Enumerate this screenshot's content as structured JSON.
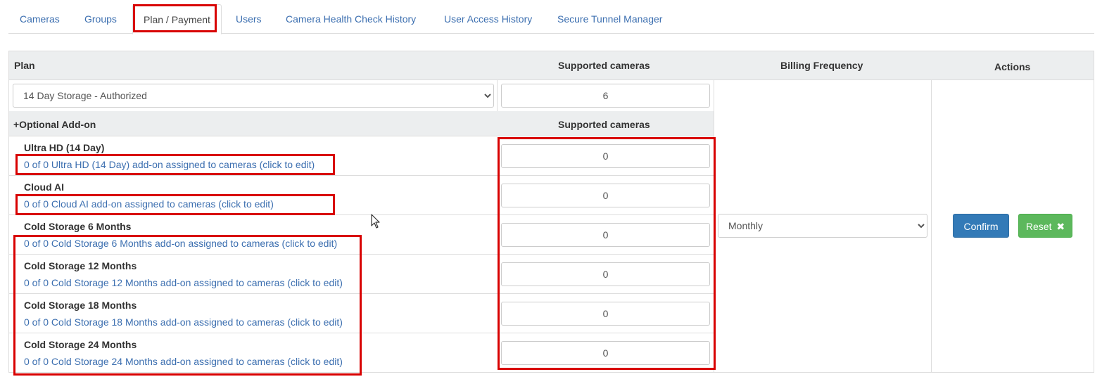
{
  "tabs": [
    {
      "label": "Cameras"
    },
    {
      "label": "Groups"
    },
    {
      "label": "Plan / Payment",
      "active": true
    },
    {
      "label": "Users"
    },
    {
      "label": "Camera Health Check History"
    },
    {
      "label": "User Access History"
    },
    {
      "label": "Secure Tunnel Manager"
    }
  ],
  "table": {
    "headers": {
      "plan": "Plan",
      "supported_cameras": "Supported cameras",
      "billing_frequency": "Billing Frequency",
      "actions": "Actions"
    },
    "plan": {
      "selected": "14 Day Storage - Authorized",
      "supported_cameras": "6"
    },
    "addon_headers": {
      "title": "+Optional Add-on",
      "supported_cameras": "Supported cameras"
    },
    "addons": [
      {
        "name": "Ultra HD (14 Day)",
        "link": "0 of 0 Ultra HD (14 Day) add-on assigned to cameras (click to edit)",
        "value": "0"
      },
      {
        "name": "Cloud AI",
        "link": "0 of 0 Cloud AI add-on assigned to cameras (click to edit)",
        "value": "0"
      },
      {
        "name": "Cold Storage 6 Months",
        "link": "0 of 0 Cold Storage 6 Months add-on assigned to cameras (click to edit)",
        "value": "0"
      },
      {
        "name": "Cold Storage 12 Months",
        "link": "0 of 0 Cold Storage 12 Months add-on assigned to cameras (click to edit)",
        "value": "0"
      },
      {
        "name": "Cold Storage 18 Months",
        "link": "0 of 0 Cold Storage 18 Months add-on assigned to cameras (click to edit)",
        "value": "0"
      },
      {
        "name": "Cold Storage 24 Months",
        "link": "0 of 0 Cold Storage 24 Months add-on assigned to cameras (click to edit)",
        "value": "0"
      }
    ],
    "billing_frequency": "Monthly",
    "actions": {
      "confirm_label": "Confirm",
      "reset_label": "Reset",
      "reset_icon": "times-icon"
    }
  },
  "colors": {
    "link": "#3c6fb0",
    "confirm": "#337ab7",
    "reset": "#5cb85c",
    "highlight": "#d80000",
    "header_bg": "#eceeef"
  }
}
